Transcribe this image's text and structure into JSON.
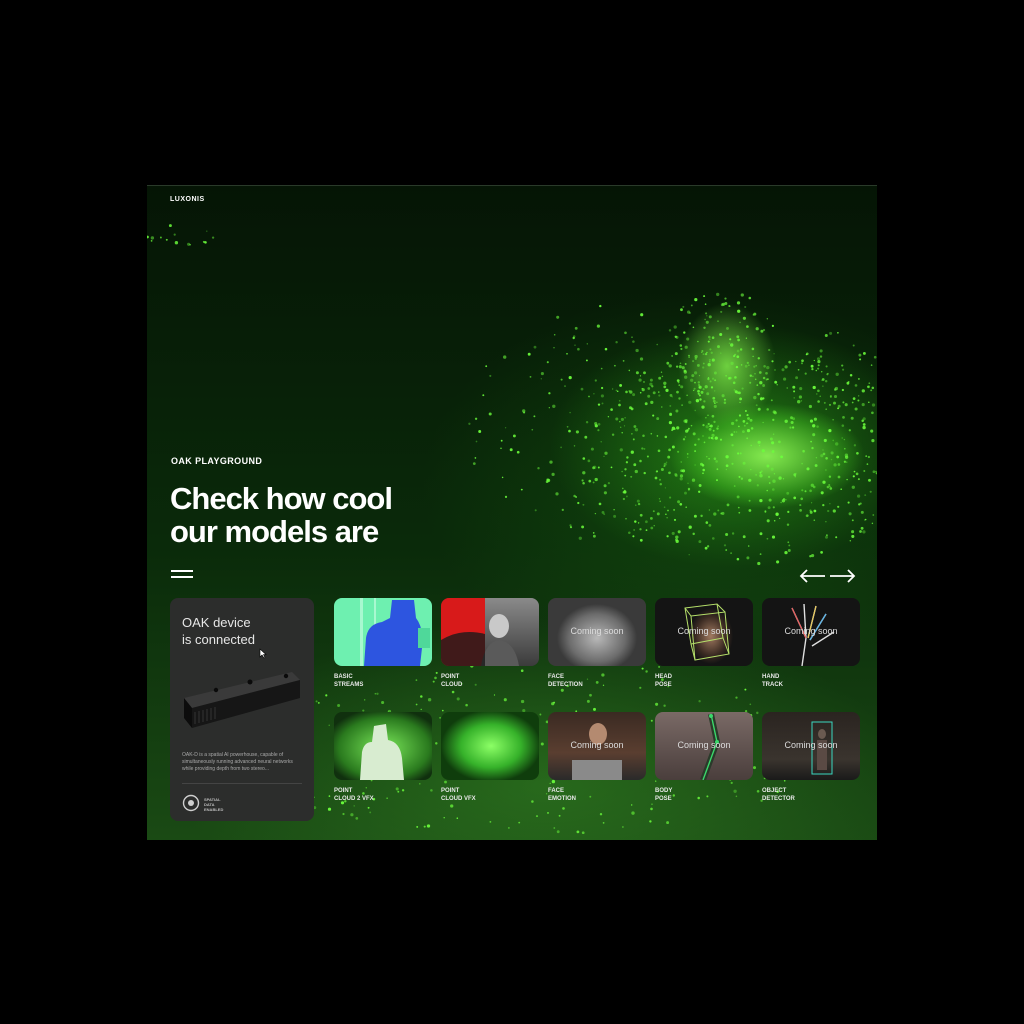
{
  "brand": {
    "logo": "LUXONIS"
  },
  "hero": {
    "eyebrow": "OAK PLAYGROUND",
    "headline_line1": "Check how cool",
    "headline_line2": "our models are"
  },
  "icons": {
    "menu": "hamburger-icon",
    "prev": "arrow-left-icon",
    "next": "arrow-right-icon",
    "badge": "spatial-ai-badge-icon",
    "cursor": "mouse-cursor-icon"
  },
  "device_card": {
    "title_line1": "OAK device",
    "title_line2": "is connected",
    "description": "OAK-D is a spatial AI powerhouse, capable of simultaneously running advanced neural networks while providing depth from two stereo...",
    "badge_line1": "SPATIAL",
    "badge_line2": "DATA",
    "badge_line3": "ENABLED"
  },
  "coming_soon_label": "Coming soon",
  "tiles": [
    {
      "line1": "BASIC",
      "line2": "STREAMS",
      "coming_soon": false
    },
    {
      "line1": "POINT",
      "line2": "CLOUD",
      "coming_soon": false
    },
    {
      "line1": "FACE",
      "line2": "DETECTION",
      "coming_soon": true
    },
    {
      "line1": "HEAD",
      "line2": "POSE",
      "coming_soon": true
    },
    {
      "line1": "HAND",
      "line2": "TRACK",
      "coming_soon": true
    },
    {
      "line1": "POINT",
      "line2": "CLOUD 2 VFX",
      "coming_soon": false
    },
    {
      "line1": "POINT",
      "line2": "CLOUD VFX",
      "coming_soon": false
    },
    {
      "line1": "FACE",
      "line2": "EMOTION",
      "coming_soon": true
    },
    {
      "line1": "BODY",
      "line2": "POSE",
      "coming_soon": true
    },
    {
      "line1": "OBJECT",
      "line2": "DETECTOR",
      "coming_soon": true
    }
  ],
  "colors": {
    "accent_green": "#6cff3c",
    "card_bg": "#2c2d2c",
    "streams_mint": "#6ef0b0",
    "streams_blue": "#2d55e0",
    "pointcloud_red": "#d81a1a"
  }
}
